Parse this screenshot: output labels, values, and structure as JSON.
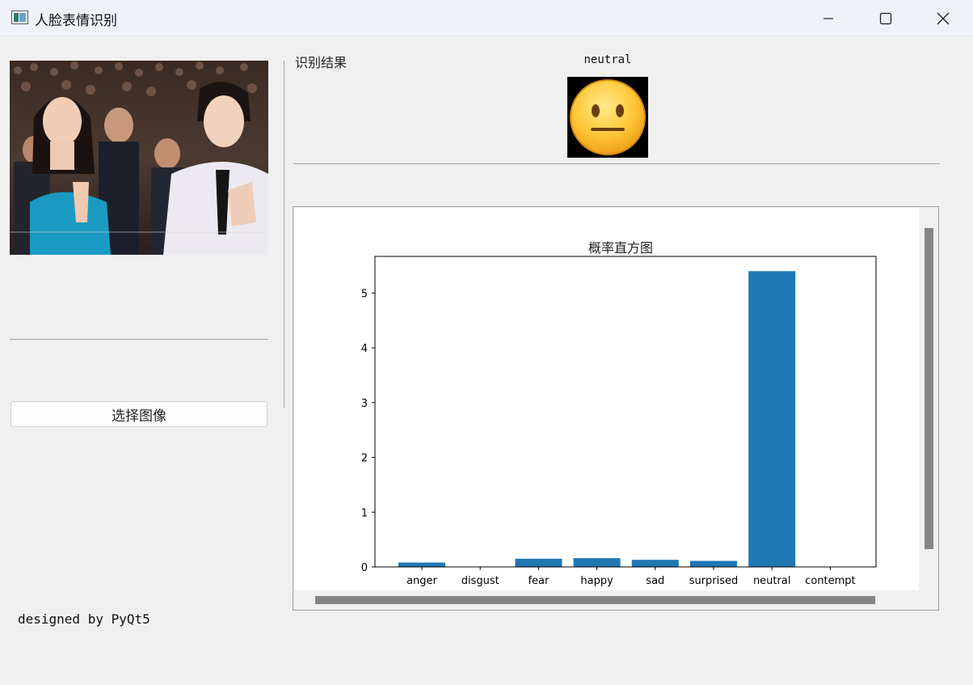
{
  "window": {
    "title": "人脸表情识别"
  },
  "left": {
    "select_button": "选择图像",
    "footer": "designed by PyQt5"
  },
  "result": {
    "label": "识别结果",
    "emotion": "neutral",
    "emoji_icon": "neutral-face-emoji"
  },
  "chart_data": {
    "type": "bar",
    "title": "概率直方图",
    "categories": [
      "anger",
      "disgust",
      "fear",
      "happy",
      "sad",
      "surprised",
      "neutral",
      "contempt"
    ],
    "values": [
      0.08,
      0.0,
      0.15,
      0.16,
      0.13,
      0.11,
      5.4,
      0.0
    ],
    "yticks": [
      0,
      1,
      2,
      3,
      4,
      5
    ],
    "ylim": [
      0,
      5.67
    ],
    "bar_color": "#1f77b4",
    "grid": false
  },
  "colors": {
    "bar": "#1f77b4",
    "window_bg": "#f0f0f0",
    "titlebar_bg": "#eff3f9"
  }
}
